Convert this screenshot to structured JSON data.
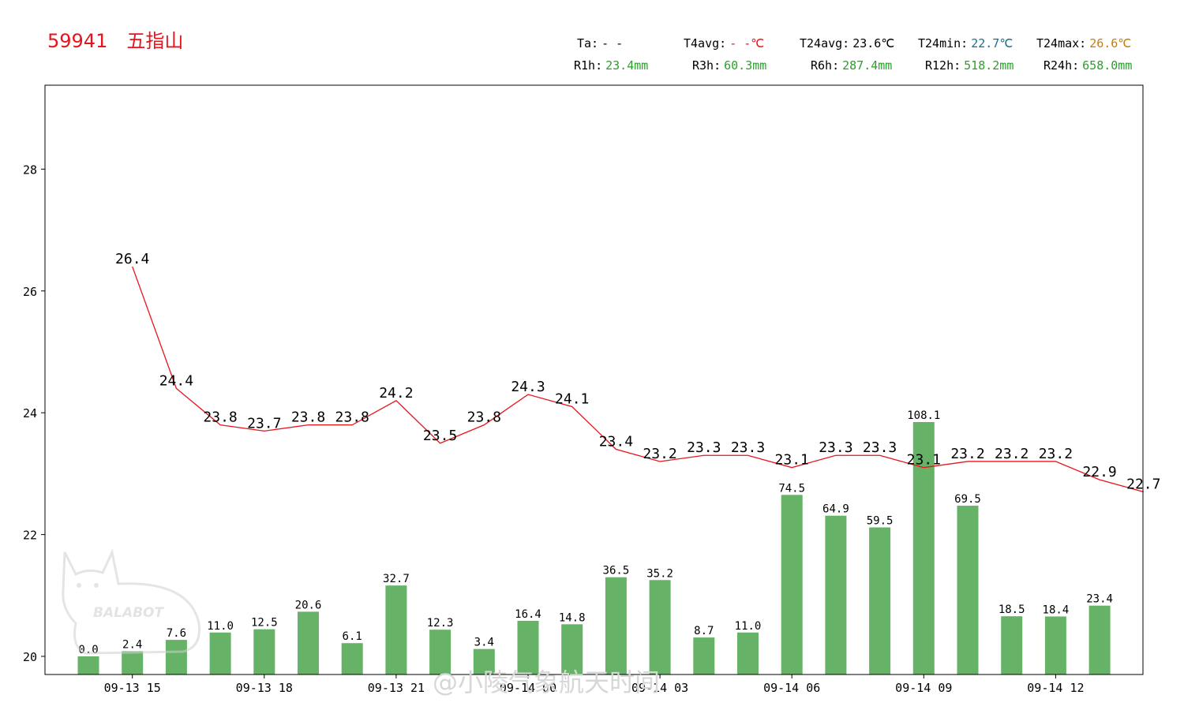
{
  "header": {
    "station": "59941　五指山",
    "stats_row1": [
      {
        "label": "Ta:",
        "value": "- -",
        "color": "#000000"
      },
      {
        "label": "T4avg:",
        "value": "- -℃",
        "color": "#e8141c"
      },
      {
        "label": "T24avg:",
        "value": "23.6℃",
        "color": "#000000"
      },
      {
        "label": "T24min:",
        "value": "22.7℃",
        "color": "#1f6b8f"
      },
      {
        "label": "T24max:",
        "value": "26.6℃",
        "color": "#c67c12"
      }
    ],
    "stats_row2": [
      {
        "label": "R1h:",
        "value": "23.4mm",
        "color": "#2aa02a"
      },
      {
        "label": "R3h:",
        "value": "60.3mm",
        "color": "#2aa02a"
      },
      {
        "label": "R6h:",
        "value": "287.4mm",
        "color": "#2aa02a"
      },
      {
        "label": "R12h:",
        "value": "518.2mm",
        "color": "#2aa02a"
      },
      {
        "label": "R24h:",
        "value": "658.0mm",
        "color": "#2aa02a"
      }
    ]
  },
  "watermark": {
    "text": "@小陵气象航天时间",
    "logo_text": "BALABOT"
  },
  "chart_data": {
    "type": "bar+line",
    "x_tick_labels": [
      "09-13 15",
      "09-13 18",
      "09-13 21",
      "09-14 00",
      "09-14 03",
      "09-14 06",
      "09-14 09",
      "09-14 12"
    ],
    "x_tick_positions": [
      1,
      4,
      7,
      10,
      13,
      16,
      19,
      22
    ],
    "y_axis": {
      "ylim": [
        19.7,
        29.3
      ],
      "ticks": [
        20,
        22,
        24,
        26,
        28
      ]
    },
    "bar_scale": {
      "mm_at_y20": 0,
      "mm_per_degree": 28.1
    },
    "grid": false,
    "series": [
      {
        "type": "bar",
        "color": "#66b266",
        "x": [
          0,
          1,
          2,
          3,
          4,
          5,
          6,
          7,
          8,
          9,
          10,
          11,
          12,
          13,
          14,
          15,
          16,
          17,
          18,
          19,
          20,
          21,
          22,
          23
        ],
        "values": [
          0.0,
          2.4,
          7.6,
          11.0,
          12.5,
          20.6,
          6.1,
          32.7,
          12.3,
          3.4,
          16.4,
          14.8,
          36.5,
          35.2,
          8.7,
          11.0,
          74.5,
          64.9,
          59.5,
          108.1,
          69.5,
          18.5,
          18.4,
          23.4
        ]
      },
      {
        "type": "line",
        "color": "#e8141c",
        "x": [
          1,
          2,
          3,
          4,
          5,
          6,
          7,
          8,
          9,
          10,
          11,
          12,
          13,
          14,
          15,
          16,
          17,
          18,
          19,
          20,
          21,
          22,
          23,
          24
        ],
        "values": [
          26.4,
          24.4,
          23.8,
          23.7,
          23.8,
          23.8,
          24.2,
          23.5,
          23.8,
          24.3,
          24.1,
          23.4,
          23.2,
          23.3,
          23.3,
          23.1,
          23.3,
          23.3,
          23.1,
          23.2,
          23.2,
          23.2,
          22.9,
          22.7
        ]
      }
    ]
  }
}
